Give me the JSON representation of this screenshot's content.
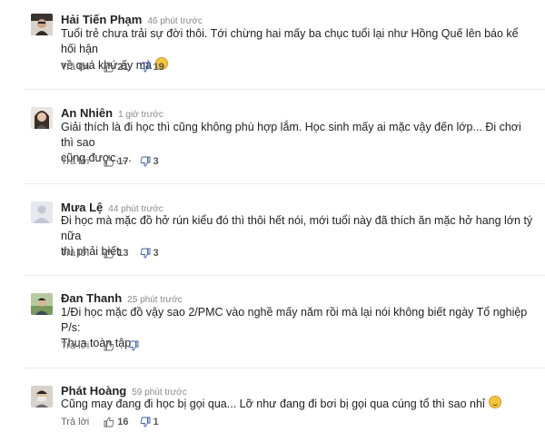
{
  "colors": {
    "accent_blue": "#3a5da8",
    "text": "#222222",
    "muted": "#888888"
  },
  "icons": {
    "like": "thumbs-up-icon",
    "dislike": "thumbs-down-icon"
  },
  "comments": [
    {
      "name": "Hải Tiến Phạm",
      "time": "46 phút trước",
      "lines": [
        "Tuổi trẻ chưa trải sự đời thôi. Tới chừng hai mấy ba chục tuổi lại như Hồng Quế lên báo kể hối hận",
        "về quá khứ ấy mà"
      ],
      "reply": "Trả lời",
      "likes": "21",
      "dislikes": "19"
    },
    {
      "name": "An Nhiên",
      "time": "1 giờ trước",
      "lines": [
        "Giải thích là đi học thì cũng không phù hợp lắm. Học sinh mấy ai mặc vậy đến lớp... Đi chơi thì sao",
        "cũng được, ..."
      ],
      "reply": "Trả lời",
      "likes": "17",
      "dislikes": "3"
    },
    {
      "name": "Mưa Lệ",
      "time": "44 phút trước",
      "lines": [
        "Đi học mà mặc đồ hở rún kiểu đó thì thôi hết nói, mới tuổi này đã thích ăn mặc hở hang lớn tý nữa",
        "thì phải biết"
      ],
      "reply": "Trả lời",
      "likes": "13",
      "dislikes": "3"
    },
    {
      "name": "Đan Thanh",
      "time": "25 phút trước",
      "lines": [
        "1/Đi học mặc đồ vậy sao 2/PMC vào nghề mấy năm rồi mà lại nói không biết ngày Tổ nghiệp P/s:",
        "Thua toàn tập"
      ],
      "reply": "Trả lời",
      "likes": "",
      "dislikes": ""
    },
    {
      "name": "Phát Hoàng",
      "time": "59 phút trước",
      "lines": [
        "Cũng may đang đi học bị gọi qua... Lỡ như đang đi bơi bị gọi qua cúng tổ thì sao nhỉ"
      ],
      "reply": "Trả lời",
      "likes": "16",
      "dislikes": "1"
    }
  ]
}
